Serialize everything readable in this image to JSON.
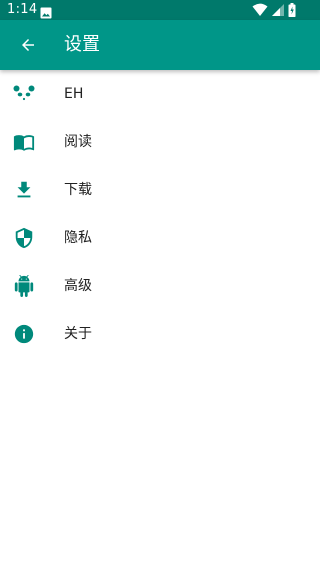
{
  "theme": {
    "status_bar_color": "#00796B",
    "toolbar_color": "#009688",
    "icon_color": "#00897B",
    "text_color": "#212121"
  },
  "status_bar": {
    "time": "1:14",
    "icons": [
      "image-notification-icon",
      "wifi-icon",
      "cell-signal-icon",
      "battery-icon"
    ]
  },
  "toolbar": {
    "back_icon": "arrow-back-icon",
    "title": "设置"
  },
  "settings": {
    "items": [
      {
        "icon": "panda-icon",
        "label": "EH"
      },
      {
        "icon": "book-icon",
        "label": "阅读"
      },
      {
        "icon": "download-icon",
        "label": "下载"
      },
      {
        "icon": "shield-icon",
        "label": "隐私"
      },
      {
        "icon": "android-icon",
        "label": "高级"
      },
      {
        "icon": "info-icon",
        "label": "关于"
      }
    ]
  }
}
